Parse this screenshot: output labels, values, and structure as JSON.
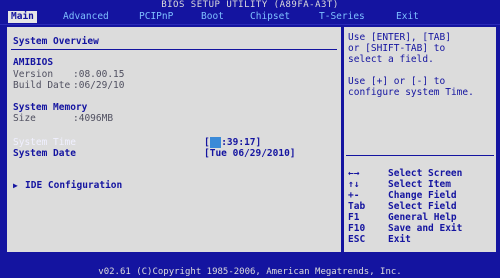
{
  "title": "BIOS SETUP UTILITY   (A89FA-A3T)",
  "menu": [
    {
      "label": "Main"
    },
    {
      "label": "Advanced"
    },
    {
      "label": "PCIPnP"
    },
    {
      "label": "Boot"
    },
    {
      "label": "Chipset"
    },
    {
      "label": "T-Series"
    },
    {
      "label": "Exit"
    }
  ],
  "main": {
    "heading": "System Overview",
    "amibios_label": "AMIBIOS",
    "version_label": "Version",
    "version_value": ":08.00.15",
    "build_label": "Build Date",
    "build_value": ":06/29/10",
    "memory_label": "System Memory",
    "size_label": "Size",
    "size_value": ":4096MB",
    "time_label": "System Time",
    "time_open": "[",
    "time_cursor": "  ",
    "time_rest": ":39:17]",
    "date_label": "System Date",
    "date_value": "[Tue 06/29/2010]",
    "ide_arrow": "▶",
    "ide_label": "IDE Configuration"
  },
  "help": {
    "lines": [
      "Use [ENTER], [TAB]",
      "or [SHIFT-TAB] to",
      "select a field.",
      "",
      "Use [+] or [-] to",
      "configure system Time."
    ]
  },
  "keys": [
    {
      "key": "←→",
      "desc": "Select Screen"
    },
    {
      "key": "↑↓",
      "desc": "Select Item"
    },
    {
      "key": "+-",
      "desc": "Change Field"
    },
    {
      "key": "Tab",
      "desc": "Select Field"
    },
    {
      "key": "F1",
      "desc": "General Help"
    },
    {
      "key": "F10",
      "desc": "Save and Exit"
    },
    {
      "key": "ESC",
      "desc": "Exit"
    }
  ],
  "footer": "v02.61 (C)Copyright 1985-2006, American Megatrends, Inc."
}
